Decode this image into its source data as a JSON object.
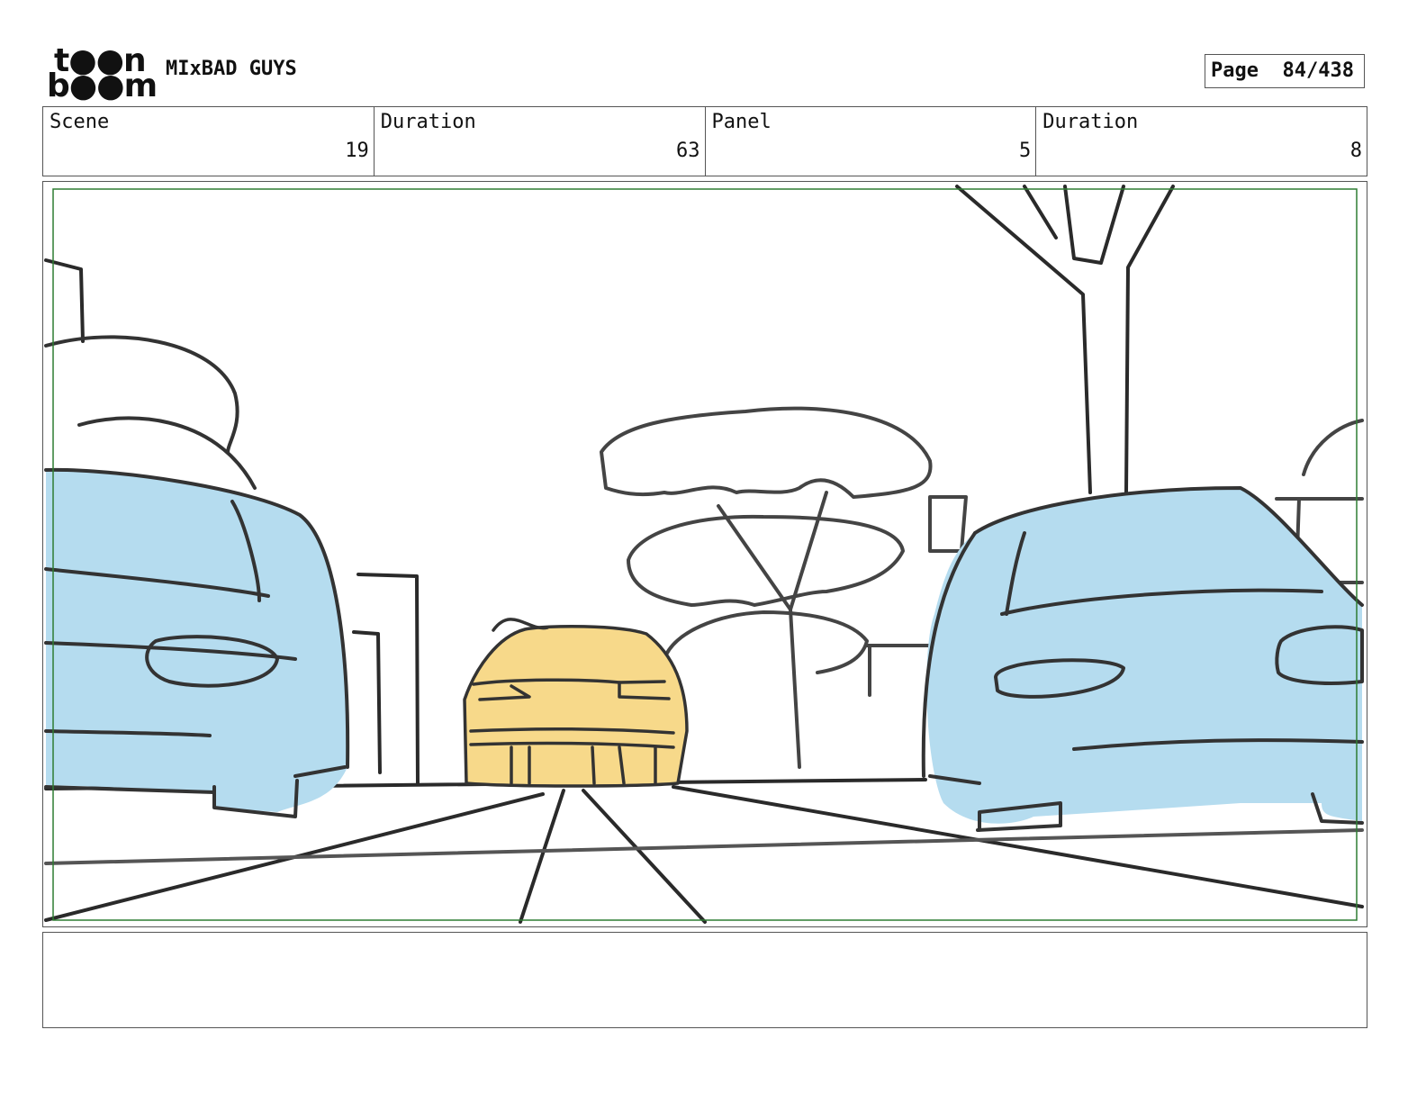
{
  "header": {
    "logo_line1": "t●●n",
    "logo_line2": "b●●m",
    "project_title": "MIxBAD GUYS",
    "page_label": "Page",
    "page_value": "84/438"
  },
  "info_row": [
    {
      "label": "Scene",
      "value": "19"
    },
    {
      "label": "Duration",
      "value": "63"
    },
    {
      "label": "Panel",
      "value": "5"
    },
    {
      "label": "Duration",
      "value": "8"
    }
  ],
  "panel": {
    "description": "",
    "colors": {
      "frame_guide": "#2e7d32",
      "car_blue": "#b5dcef",
      "car_yellow": "#f7d98a",
      "ink": "#222222"
    }
  },
  "notes": {
    "text": ""
  }
}
